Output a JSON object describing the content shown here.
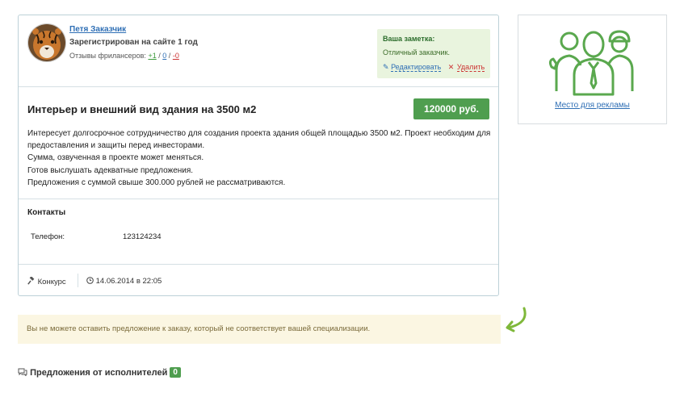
{
  "customer": {
    "name": "Петя Заказчик",
    "registered": "Зарегистрирован на сайте 1 год",
    "reviews_label": "Отзывы фрилансеров:",
    "reviews_positive": "+1",
    "reviews_neutral": "0",
    "reviews_negative": "-0"
  },
  "note": {
    "title": "Ваша заметка:",
    "text": "Отличный заказчик.",
    "edit_label": "Редактировать",
    "delete_label": "Удалить"
  },
  "order": {
    "title": "Интерьер и внешний вид здания на 3500 м2",
    "price": "120000 руб.",
    "description_lines": [
      "Интересует долгосрочное сотрудничество для создания проекта здания общей площадью 3500 м2. Проект необходим для",
      "предоставления и защиты перед инвесторами.",
      "Сумма, озвученная в проекте может меняться.",
      "Готов выслушать адекватные предложения.",
      "Предложения с суммой свыше 300.000 рублей не рассматриваются."
    ],
    "contacts_heading": "Контакты",
    "phone_label": "Телефон:",
    "phone_value": "123124234",
    "type": "Конкурс",
    "date": "14.06.2014 в 22:05"
  },
  "ad": {
    "link_text": "Место для рекламы"
  },
  "warning": "Вы не можете оставить предложение к заказу, который не соответствует вашей специализации.",
  "offers": {
    "heading": "Предложения от исполнителей",
    "count": "0"
  },
  "colors": {
    "accent_green": "#4f9e4f",
    "link_blue": "#2f6fb5",
    "danger_red": "#cc3333",
    "note_bg": "#e9f4de",
    "warning_bg": "#fbf6e2"
  }
}
